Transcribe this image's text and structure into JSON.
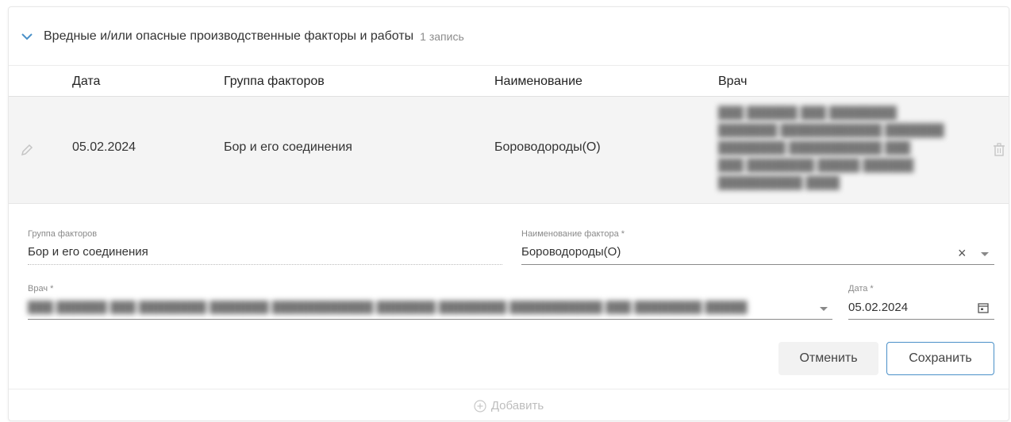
{
  "section": {
    "title": "Вредные и/или опасные производственные факторы и работы",
    "count": "1 запись",
    "chevron_icon": "chevron-down-icon",
    "accent_color": "#4a90c8"
  },
  "table": {
    "columns": [
      "Дата",
      "Группа факторов",
      "Наименование",
      "Врач"
    ],
    "rows": [
      {
        "date": "05.02.2024",
        "group": "Бор и его соединения",
        "name": "Бороводороды(О)",
        "doctor_lines": [
          "███ ██████ ███ ████████",
          "███████ ████████████ ███████",
          "████████ ███████████ ███",
          "███ ████████ █████ ██████",
          "██████████ ████"
        ]
      }
    ]
  },
  "form": {
    "group_label": "Группа факторов",
    "group_value": "Бор и его соединения",
    "factor_label": "Наименование фактора *",
    "factor_value": "Бороводороды(О)",
    "doctor_label": "Врач *",
    "doctor_value": "███ ██████ ███ ████████ ███████ ████████████ ███████ ████████ ███████████ ███ ████████ █████",
    "date_label": "Дата *",
    "date_value": "05.02.2024",
    "cancel_label": "Отменить",
    "save_label": "Сохранить"
  },
  "footer": {
    "add_label": "Добавить"
  }
}
